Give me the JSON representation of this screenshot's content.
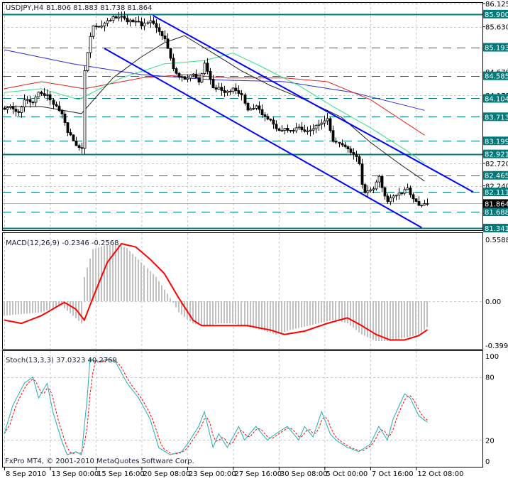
{
  "header": {
    "symbol": "USDJPY,H4",
    "ohlc": "81.806 81.883 81.738 81.864"
  },
  "macd_header": "MACD(12,26,9) -0.2346 -0.2568",
  "stoch_header": "Stoch(13,3,3) 37.0323 40.2769",
  "copyright": "FxPro MT4, © 2001-2010 MetaQuotes Software Corp.",
  "colors": {
    "level": "#007b7b",
    "channel": "#0000ff",
    "ma_blue": "#2b2bd6",
    "ma_red": "#e02020",
    "ma_green": "#30e080",
    "ma_black": "#202020",
    "macd_hist": "#c0c0c0",
    "macd_signal": "#ff0000",
    "stoch_main": "#20b0b0",
    "stoch_signal": "#ff0000",
    "grid": "#c8c8c8"
  },
  "chart_data": {
    "type": "candlestick",
    "symbol": "USDJPY",
    "timeframe": "H4",
    "price_axis_ticks": [
      "86.125",
      "85.630",
      "84.670",
      "84.175",
      "82.720",
      "82.240"
    ],
    "price_range": [
      81.341,
      86.125
    ],
    "current_price": "81.864",
    "levels": [
      {
        "price": "85.900",
        "style": "solid"
      },
      {
        "price": "85.193",
        "style": "dashed"
      },
      {
        "price": "84.585",
        "style": "dashed"
      },
      {
        "price": "84.104",
        "style": "dashed"
      },
      {
        "price": "83.713",
        "style": "dashed"
      },
      {
        "price": "83.199",
        "style": "dashed"
      },
      {
        "price": "82.921",
        "style": "solid"
      },
      {
        "price": "82.465",
        "style": "dashed"
      },
      {
        "price": "82.111",
        "style": "dashed"
      },
      {
        "price": "81.688",
        "style": "dashed"
      },
      {
        "price": "81.341",
        "style": "solid"
      }
    ],
    "time_labels": [
      {
        "bar": 0,
        "label": "8 Sep 2010"
      },
      {
        "bar": 16,
        "label": "13 Sep 00:00"
      },
      {
        "bar": 32,
        "label": "15 Sep 16:00"
      },
      {
        "bar": 48,
        "label": "20 Sep 08:00"
      },
      {
        "bar": 64,
        "label": "23 Sep 00:00"
      },
      {
        "bar": 80,
        "label": "27 Sep 16:00"
      },
      {
        "bar": 96,
        "label": "30 Sep 08:00"
      },
      {
        "bar": 112,
        "label": "5 Oct 00:00"
      },
      {
        "bar": 128,
        "label": "7 Oct 16:00"
      },
      {
        "bar": 144,
        "label": "12 Oct 08:00"
      }
    ],
    "close": [
      [
        0,
        83.85
      ],
      [
        2,
        83.93
      ],
      [
        5,
        83.78
      ],
      [
        7,
        84.08
      ],
      [
        10,
        84.0
      ],
      [
        12,
        84.23
      ],
      [
        15,
        84.16
      ],
      [
        17,
        84.0
      ],
      [
        20,
        83.78
      ],
      [
        22,
        83.4
      ],
      [
        25,
        83.1
      ],
      [
        27,
        83.02
      ],
      [
        28,
        84.69
      ],
      [
        30,
        85.44
      ],
      [
        31,
        85.67
      ],
      [
        33,
        85.6
      ],
      [
        36,
        85.75
      ],
      [
        38,
        85.82
      ],
      [
        41,
        85.87
      ],
      [
        43,
        85.75
      ],
      [
        46,
        85.75
      ],
      [
        48,
        85.67
      ],
      [
        51,
        85.75
      ],
      [
        53,
        85.6
      ],
      [
        56,
        85.37
      ],
      [
        58,
        84.99
      ],
      [
        59,
        84.76
      ],
      [
        61,
        84.54
      ],
      [
        63,
        84.54
      ],
      [
        66,
        84.61
      ],
      [
        68,
        84.46
      ],
      [
        70,
        84.84
      ],
      [
        72,
        84.54
      ],
      [
        73,
        84.31
      ],
      [
        75,
        84.31
      ],
      [
        78,
        84.23
      ],
      [
        80,
        84.31
      ],
      [
        83,
        84.16
      ],
      [
        85,
        83.85
      ],
      [
        88,
        83.93
      ],
      [
        90,
        83.78
      ],
      [
        93,
        83.63
      ],
      [
        96,
        83.4
      ],
      [
        98,
        83.48
      ],
      [
        100,
        83.4
      ],
      [
        103,
        83.48
      ],
      [
        105,
        83.4
      ],
      [
        108,
        83.48
      ],
      [
        110,
        83.55
      ],
      [
        113,
        83.7
      ],
      [
        114,
        83.4
      ],
      [
        115,
        83.17
      ],
      [
        118,
        83.1
      ],
      [
        120,
        83.02
      ],
      [
        123,
        82.87
      ],
      [
        124,
        82.72
      ],
      [
        125,
        82.26
      ],
      [
        126,
        82.11
      ],
      [
        129,
        82.19
      ],
      [
        131,
        82.42
      ],
      [
        133,
        82.04
      ],
      [
        134,
        81.89
      ],
      [
        136,
        82.04
      ],
      [
        139,
        82.11
      ],
      [
        141,
        82.19
      ],
      [
        142,
        82.04
      ],
      [
        145,
        81.81
      ],
      [
        148,
        81.864
      ]
    ],
    "moving_averages": {
      "blue": [
        [
          0,
          85.14
        ],
        [
          24,
          84.84
        ],
        [
          48,
          84.61
        ],
        [
          73,
          84.5
        ],
        [
          98,
          84.46
        ],
        [
          122,
          84.23
        ],
        [
          147,
          83.85
        ]
      ],
      "red": [
        [
          0,
          84.31
        ],
        [
          13,
          84.46
        ],
        [
          28,
          84.31
        ],
        [
          48,
          84.54
        ],
        [
          63,
          84.61
        ],
        [
          78,
          84.54
        ],
        [
          98,
          84.54
        ],
        [
          113,
          84.46
        ],
        [
          128,
          84.08
        ],
        [
          147,
          83.32
        ]
      ],
      "green": [
        [
          0,
          84.23
        ],
        [
          13,
          84.31
        ],
        [
          26,
          84.08
        ],
        [
          41,
          84.54
        ],
        [
          56,
          84.84
        ],
        [
          70,
          84.91
        ],
        [
          80,
          85.07
        ],
        [
          88,
          84.84
        ],
        [
          103,
          84.38
        ],
        [
          115,
          83.93
        ],
        [
          128,
          83.48
        ],
        [
          140,
          83.02
        ],
        [
          147,
          82.72
        ]
      ],
      "black": [
        [
          0,
          83.93
        ],
        [
          13,
          83.93
        ],
        [
          27,
          83.78
        ],
        [
          38,
          84.54
        ],
        [
          48,
          84.99
        ],
        [
          56,
          85.29
        ],
        [
          63,
          85.44
        ],
        [
          73,
          85.07
        ],
        [
          83,
          84.69
        ],
        [
          93,
          84.38
        ],
        [
          105,
          84.08
        ],
        [
          118,
          83.7
        ],
        [
          128,
          83.17
        ],
        [
          138,
          82.72
        ],
        [
          147,
          82.34
        ]
      ]
    },
    "channel": {
      "upper": [
        [
          52,
          85.87
        ],
        [
          164,
          82.11
        ]
      ],
      "lower": [
        [
          35,
          85.17
        ],
        [
          146,
          81.35
        ]
      ]
    },
    "macd": {
      "ticks": [
        "0.5588",
        "0.00",
        "-0.399"
      ],
      "range": [
        -0.399,
        0.5588
      ],
      "histogram": [
        [
          0,
          -0.13
        ],
        [
          13,
          -0.1
        ],
        [
          20,
          -0.04
        ],
        [
          27,
          -0.2
        ],
        [
          28,
          0.22
        ],
        [
          31,
          0.47
        ],
        [
          36,
          0.51
        ],
        [
          40,
          0.51
        ],
        [
          43,
          0.48
        ],
        [
          48,
          0.35
        ],
        [
          53,
          0.22
        ],
        [
          58,
          0.03
        ],
        [
          61,
          -0.1
        ],
        [
          66,
          -0.2
        ],
        [
          70,
          -0.23
        ],
        [
          75,
          -0.2
        ],
        [
          80,
          -0.2
        ],
        [
          85,
          -0.23
        ],
        [
          90,
          -0.26
        ],
        [
          95,
          -0.3
        ],
        [
          100,
          -0.26
        ],
        [
          105,
          -0.23
        ],
        [
          110,
          -0.2
        ],
        [
          115,
          -0.17
        ],
        [
          120,
          -0.2
        ],
        [
          125,
          -0.3
        ],
        [
          130,
          -0.36
        ],
        [
          135,
          -0.36
        ],
        [
          140,
          -0.33
        ],
        [
          145,
          -0.3
        ],
        [
          148,
          -0.2346
        ]
      ],
      "signal": [
        [
          0,
          -0.17
        ],
        [
          6,
          -0.2
        ],
        [
          13,
          -0.13
        ],
        [
          21,
          -0.01
        ],
        [
          25,
          -0.07
        ],
        [
          28,
          -0.17
        ],
        [
          31,
          0.03
        ],
        [
          36,
          0.35
        ],
        [
          41,
          0.52
        ],
        [
          46,
          0.49
        ],
        [
          51,
          0.38
        ],
        [
          56,
          0.25
        ],
        [
          61,
          0.03
        ],
        [
          66,
          -0.17
        ],
        [
          69,
          -0.22
        ],
        [
          78,
          -0.22
        ],
        [
          85,
          -0.22
        ],
        [
          93,
          -0.26
        ],
        [
          98,
          -0.3
        ],
        [
          105,
          -0.27
        ],
        [
          113,
          -0.2
        ],
        [
          120,
          -0.15
        ],
        [
          125,
          -0.22
        ],
        [
          130,
          -0.3
        ],
        [
          135,
          -0.35
        ],
        [
          140,
          -0.35
        ],
        [
          145,
          -0.31
        ],
        [
          148,
          -0.2568
        ]
      ]
    },
    "stochastic": {
      "ticks": [
        "100",
        "80",
        "20",
        "0"
      ],
      "range": [
        0,
        100
      ],
      "main": [
        [
          0,
          26
        ],
        [
          3,
          53
        ],
        [
          7,
          74
        ],
        [
          10,
          80
        ],
        [
          12,
          60
        ],
        [
          15,
          74
        ],
        [
          17,
          47
        ],
        [
          20,
          20
        ],
        [
          22,
          6
        ],
        [
          25,
          9
        ],
        [
          27,
          6
        ],
        [
          29,
          60
        ],
        [
          30,
          97
        ],
        [
          33,
          94
        ],
        [
          36,
          97
        ],
        [
          39,
          94
        ],
        [
          43,
          74
        ],
        [
          47,
          60
        ],
        [
          51,
          40
        ],
        [
          54,
          13
        ],
        [
          58,
          6
        ],
        [
          62,
          9
        ],
        [
          64,
          16
        ],
        [
          68,
          33
        ],
        [
          70,
          47
        ],
        [
          73,
          13
        ],
        [
          75,
          26
        ],
        [
          78,
          13
        ],
        [
          82,
          33
        ],
        [
          84,
          20
        ],
        [
          88,
          33
        ],
        [
          92,
          20
        ],
        [
          95,
          26
        ],
        [
          99,
          33
        ],
        [
          103,
          20
        ],
        [
          105,
          33
        ],
        [
          108,
          23
        ],
        [
          111,
          47
        ],
        [
          114,
          26
        ],
        [
          116,
          20
        ],
        [
          120,
          13
        ],
        [
          124,
          9
        ],
        [
          128,
          16
        ],
        [
          131,
          33
        ],
        [
          134,
          20
        ],
        [
          136,
          40
        ],
        [
          140,
          64
        ],
        [
          142,
          60
        ],
        [
          145,
          43
        ],
        [
          148,
          37.03
        ]
      ]
    }
  }
}
